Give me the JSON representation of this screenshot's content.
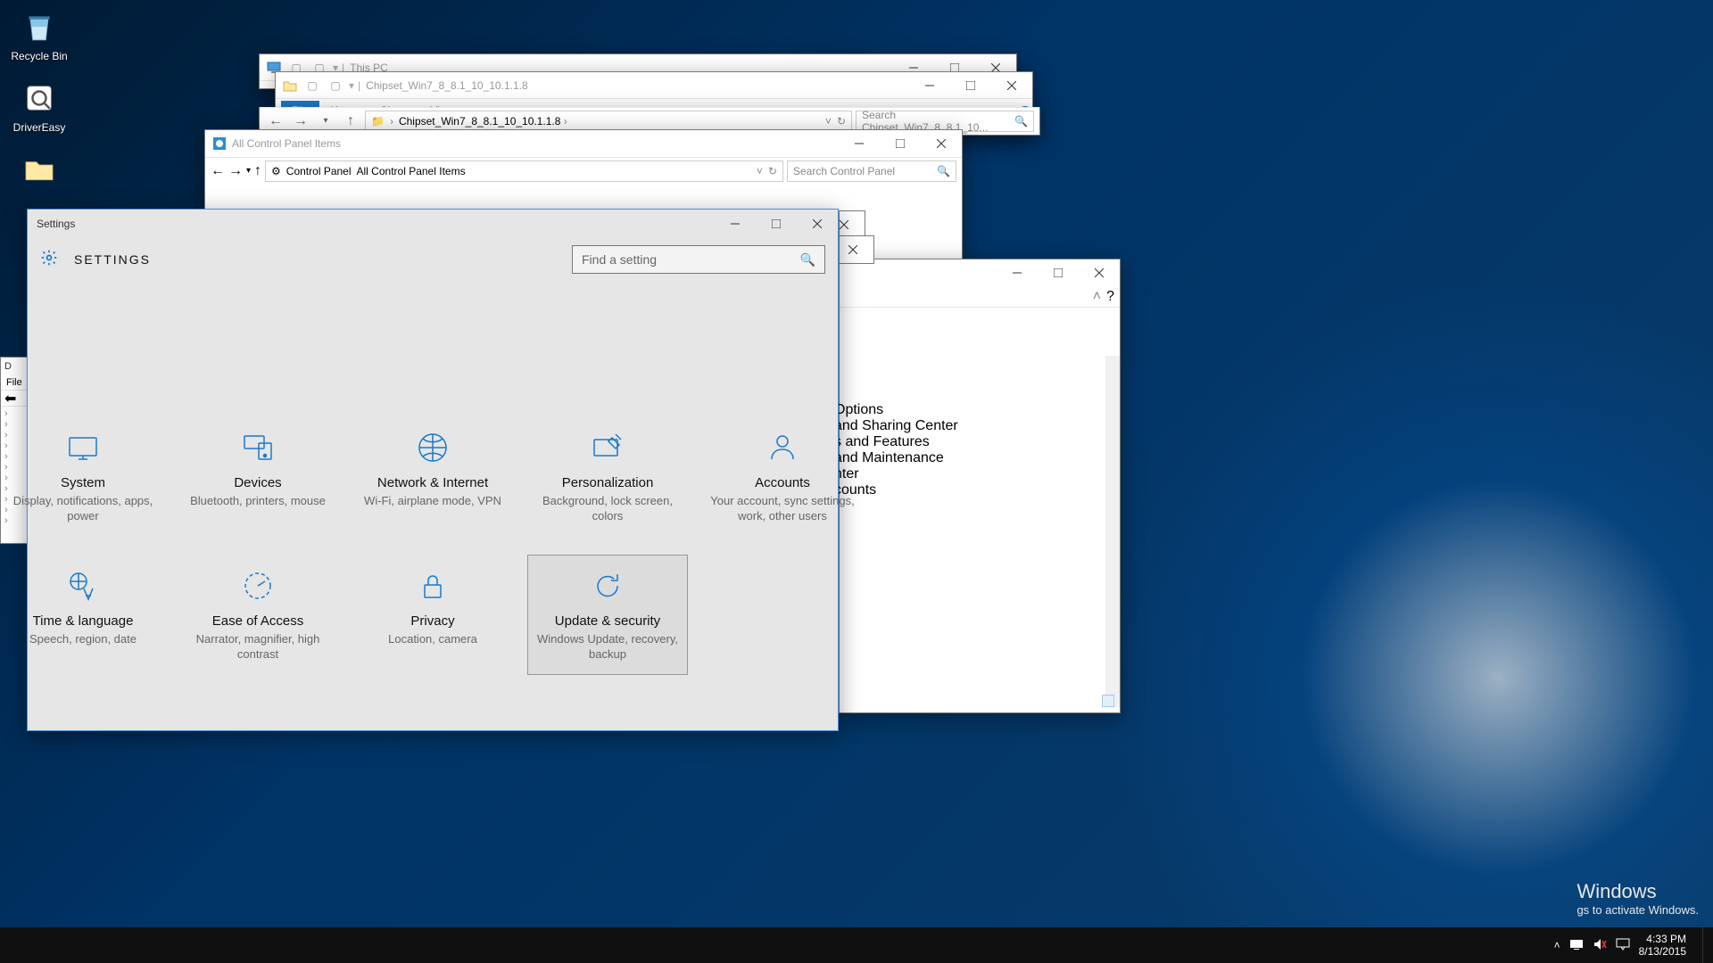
{
  "desktop": {
    "icons": [
      {
        "name": "Recycle Bin"
      },
      {
        "name": "DriverEasy"
      }
    ]
  },
  "explorer1": {
    "title": "This PC"
  },
  "explorer2": {
    "title": "Chipset_Win7_8_8.1_10_10.1.1.8",
    "tabs": {
      "file": "File",
      "home": "Home",
      "share": "Share",
      "view": "View"
    },
    "breadcrumb": [
      "",
      "Chipset_Win7_8_8.1_10_10.1.1.8"
    ],
    "search_placeholder": "Search Chipset_Win7_8_8.1_10..."
  },
  "cp": {
    "title": "All Control Panel Items",
    "breadcrumb": [
      "Control Panel",
      "All Control Panel Items"
    ],
    "search_placeholder": "Search Control Panel",
    "visible_items": [
      "Options",
      "and Sharing Center",
      "s and Features",
      "and Maintenance",
      "nter",
      "counts"
    ]
  },
  "tiny": {
    "title": "D",
    "menu": "File"
  },
  "settings": {
    "window_title": "Settings",
    "heading": "SETTINGS",
    "search_placeholder": "Find a setting",
    "tiles": [
      {
        "name": "System",
        "desc": "Display, notifications, apps, power",
        "icon": "monitor"
      },
      {
        "name": "Devices",
        "desc": "Bluetooth, printers, mouse",
        "icon": "devices"
      },
      {
        "name": "Network & Internet",
        "desc": "Wi-Fi, airplane mode, VPN",
        "icon": "globe"
      },
      {
        "name": "Personalization",
        "desc": "Background, lock screen, colors",
        "icon": "pen"
      },
      {
        "name": "Accounts",
        "desc": "Your account, sync settings, work, other users",
        "icon": "person"
      },
      {
        "name": "Time & language",
        "desc": "Speech, region, date",
        "icon": "lang"
      },
      {
        "name": "Ease of Access",
        "desc": "Narrator, magnifier, high contrast",
        "icon": "ease"
      },
      {
        "name": "Privacy",
        "desc": "Location, camera",
        "icon": "lock"
      },
      {
        "name": "Update & security",
        "desc": "Windows Update, recovery, backup",
        "icon": "update"
      }
    ],
    "hover_index": 8
  },
  "watermark": {
    "line1": "Windows",
    "line2": "gs to activate Windows."
  },
  "taskbar": {
    "time": "4:33 PM",
    "date": "8/13/2015"
  }
}
